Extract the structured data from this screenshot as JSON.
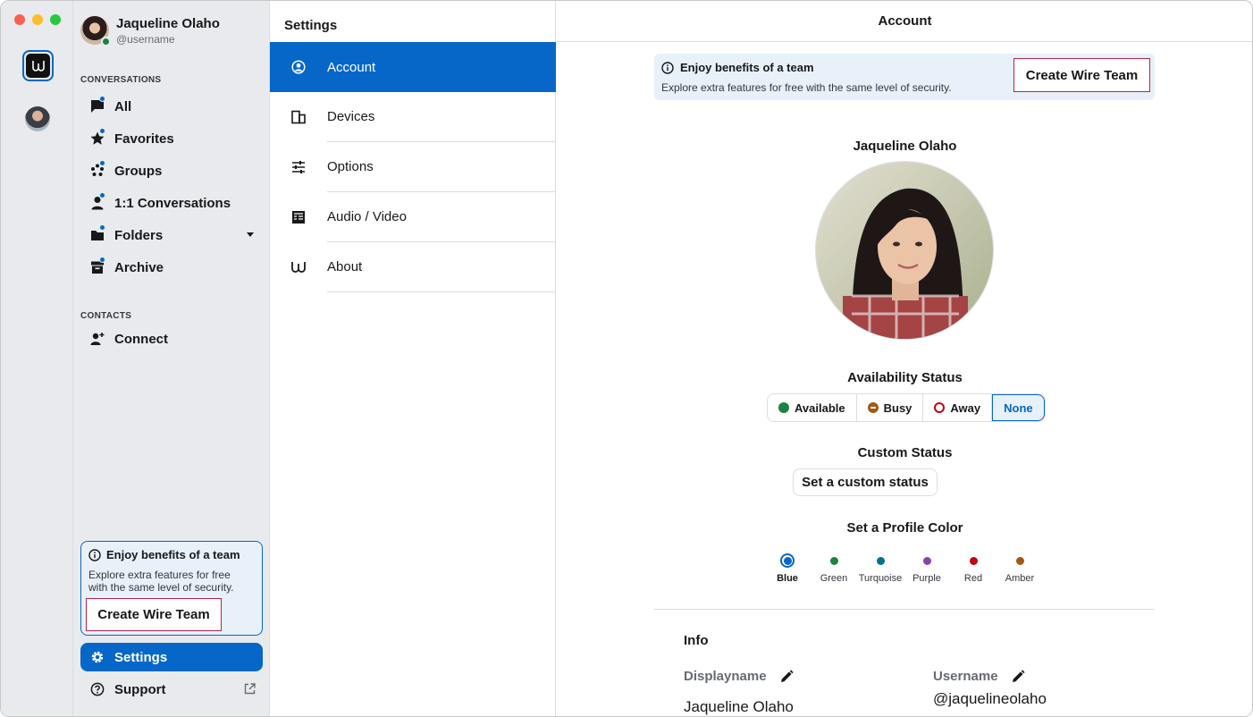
{
  "user": {
    "name": "Jaqueline Olaho",
    "handle": "@username"
  },
  "sidebar": {
    "conversations_title": "CONVERSATIONS",
    "items": [
      {
        "label": "All",
        "icon": "chat-bubble-icon"
      },
      {
        "label": "Favorites",
        "icon": "star-icon"
      },
      {
        "label": "Groups",
        "icon": "groups-icon"
      },
      {
        "label": "1:1 Conversations",
        "icon": "person-icon"
      },
      {
        "label": "Folders",
        "icon": "folder-icon"
      },
      {
        "label": "Archive",
        "icon": "archive-icon"
      }
    ],
    "contacts_title": "CONTACTS",
    "connect_label": "Connect",
    "promo": {
      "title": "Enjoy benefits of a team",
      "text": "Explore extra features for free with the same level of security.",
      "button": "Create Wire Team"
    },
    "settings_label": "Settings",
    "support_label": "Support"
  },
  "settings_menu": {
    "title": "Settings",
    "items": [
      {
        "label": "Account",
        "active": true
      },
      {
        "label": "Devices"
      },
      {
        "label": "Options"
      },
      {
        "label": "Audio / Video"
      },
      {
        "label": "About"
      }
    ]
  },
  "content": {
    "header": "Account",
    "banner": {
      "title": "Enjoy benefits of a team",
      "text": "Explore extra features for free with the same level of security.",
      "button": "Create Wire Team"
    },
    "profile_name": "Jaqueline Olaho",
    "availability": {
      "title": "Availability Status",
      "options": [
        {
          "label": "Available",
          "color": "#1d8240"
        },
        {
          "label": "Busy",
          "color": "#a25915"
        },
        {
          "label": "Away",
          "color": "#c20013"
        },
        {
          "label": "None",
          "selected": true
        }
      ]
    },
    "custom_status": {
      "title": "Custom Status",
      "button": "Set a custom status"
    },
    "profile_color": {
      "title": "Set a Profile Color",
      "options": [
        {
          "label": "Blue",
          "color": "#0667c8",
          "selected": true
        },
        {
          "label": "Green",
          "color": "#1d8240"
        },
        {
          "label": "Turquoise",
          "color": "#01718e"
        },
        {
          "label": "Purple",
          "color": "#8944ab"
        },
        {
          "label": "Red",
          "color": "#c20013"
        },
        {
          "label": "Amber",
          "color": "#a25915"
        }
      ]
    },
    "info": {
      "title": "Info",
      "displayname_label": "Displayname",
      "displayname_value": "Jaqueline Olaho",
      "username_label": "Username",
      "username_value": "@jaquelineolaho"
    }
  },
  "colors": {
    "accent": "#0667c8",
    "highlight_border": "#b4244a",
    "sidebar_bg": "#e9eaed"
  }
}
